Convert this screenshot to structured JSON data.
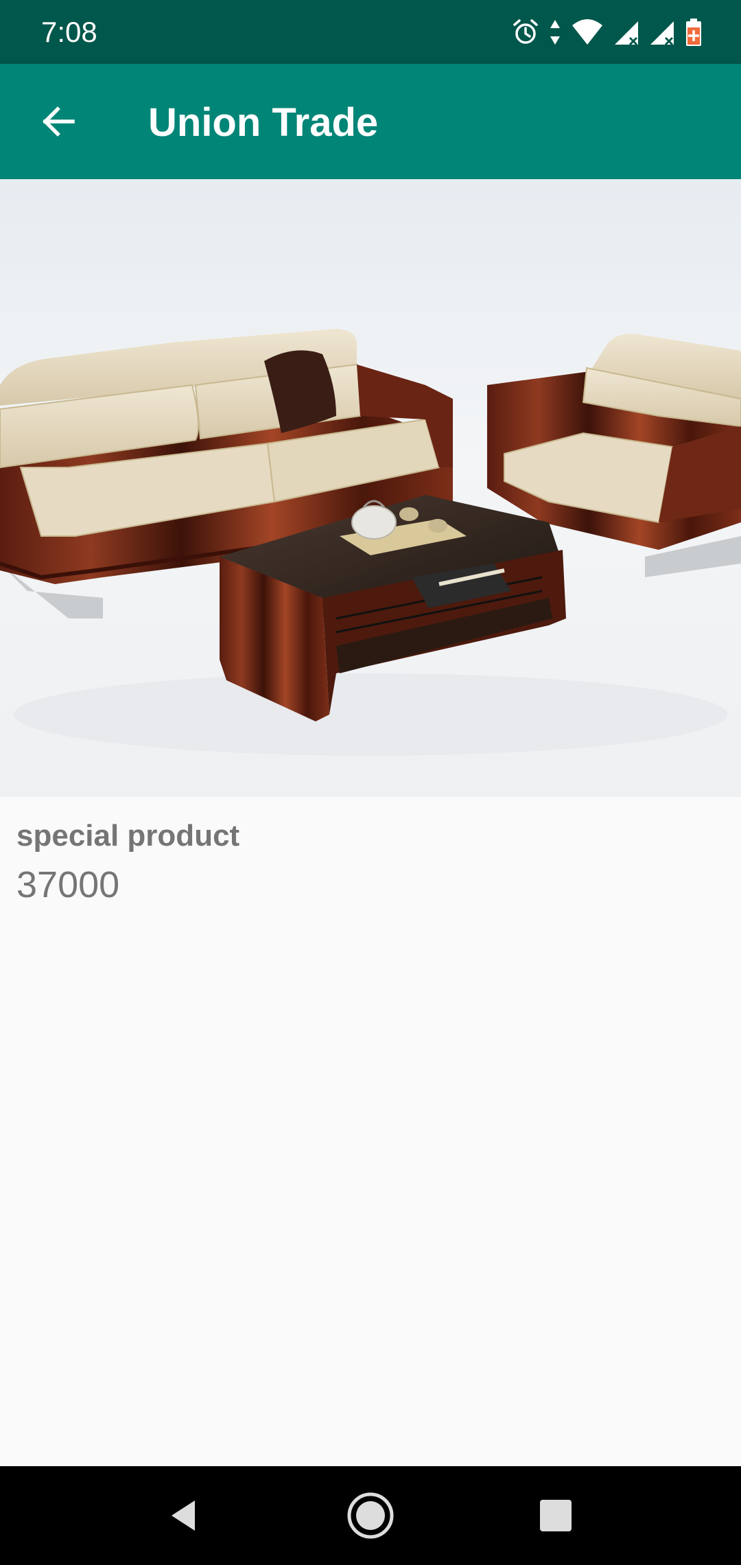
{
  "status_bar": {
    "time": "7:08",
    "icons": [
      "alarm-icon",
      "data-arrows-icon",
      "wifi-icon",
      "signal-icon",
      "signal-icon",
      "battery-charging-icon"
    ]
  },
  "app_bar": {
    "title": "Union Trade",
    "back_icon": "arrow-back-icon",
    "color": "#008577",
    "status_color": "#00574b"
  },
  "product": {
    "name": "special product",
    "price": "37000",
    "image": "sofa-set-photo"
  },
  "nav_bar": {
    "buttons": [
      "back-triangle-icon",
      "home-circle-icon",
      "recents-square-icon"
    ]
  }
}
